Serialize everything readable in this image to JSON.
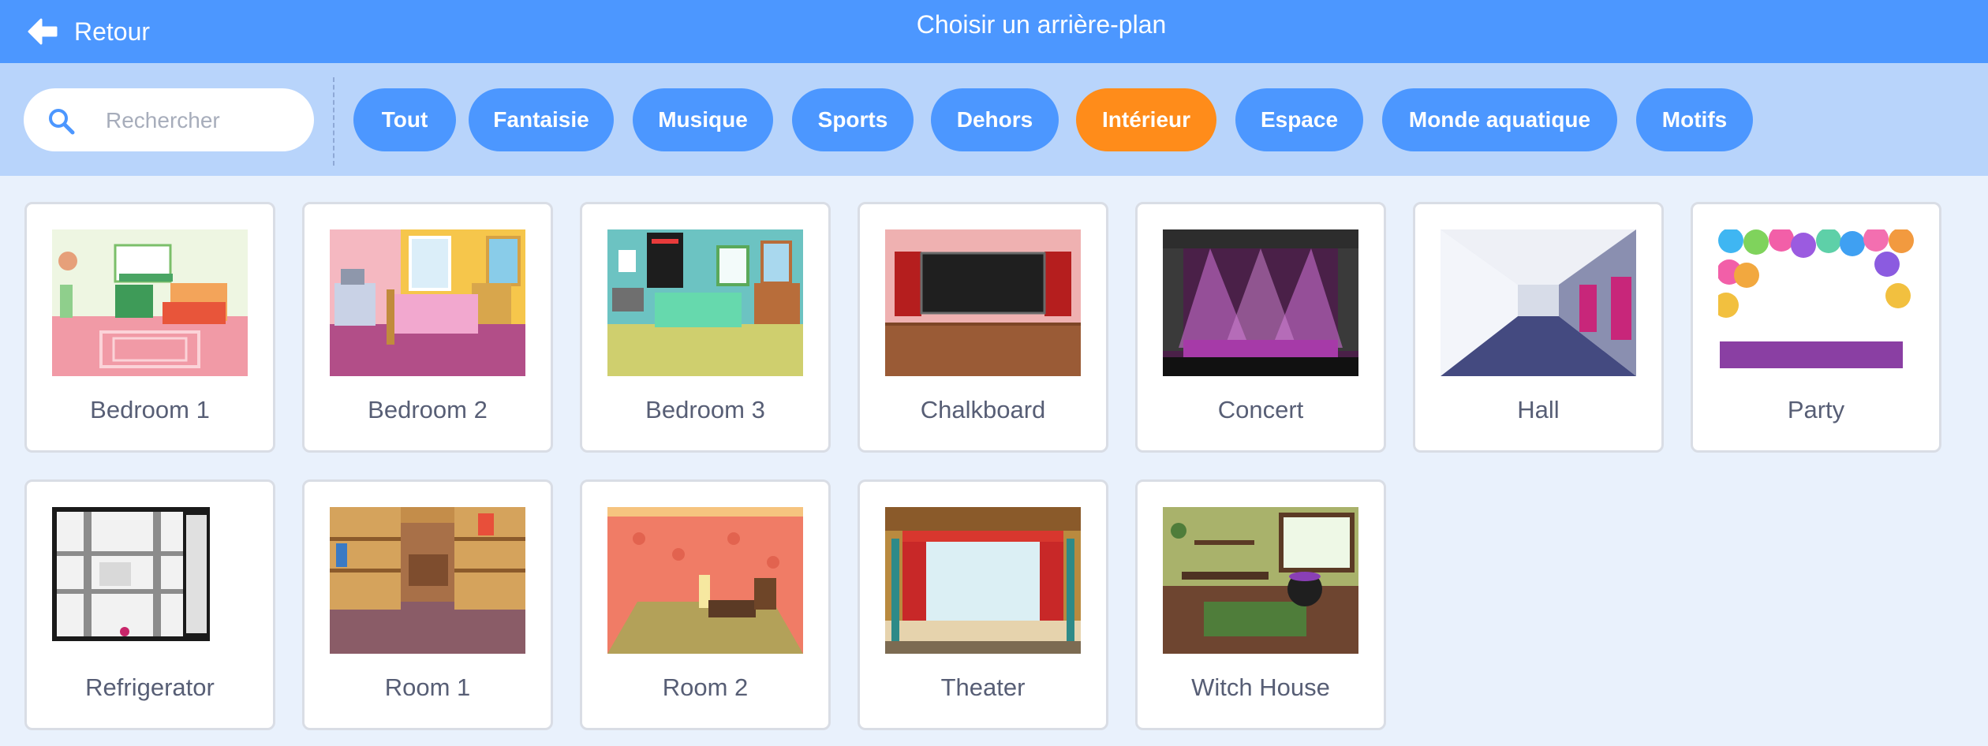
{
  "header": {
    "back_label": "Retour",
    "title": "Choisir un arrière-plan"
  },
  "search": {
    "placeholder": "Rechercher",
    "value": ""
  },
  "tags": [
    {
      "label": "Tout",
      "active": false
    },
    {
      "label": "Fantaisie",
      "active": false
    },
    {
      "label": "Musique",
      "active": false
    },
    {
      "label": "Sports",
      "active": false
    },
    {
      "label": "Dehors",
      "active": false
    },
    {
      "label": "Intérieur",
      "active": true
    },
    {
      "label": "Espace",
      "active": false
    },
    {
      "label": "Monde aquatique",
      "active": false
    },
    {
      "label": "Motifs",
      "active": false
    }
  ],
  "backdrops": [
    {
      "label": "Bedroom 1"
    },
    {
      "label": "Bedroom 2"
    },
    {
      "label": "Bedroom 3"
    },
    {
      "label": "Chalkboard"
    },
    {
      "label": "Concert"
    },
    {
      "label": "Hall"
    },
    {
      "label": "Party"
    },
    {
      "label": "Refrigerator"
    },
    {
      "label": "Room 1"
    },
    {
      "label": "Room 2"
    },
    {
      "label": "Theater"
    },
    {
      "label": "Witch House"
    }
  ],
  "colors": {
    "header": "#4c97ff",
    "filter_bar": "#b8d4fb",
    "active_tag": "#ff8c1a",
    "page_bg": "#e9f1fc"
  }
}
